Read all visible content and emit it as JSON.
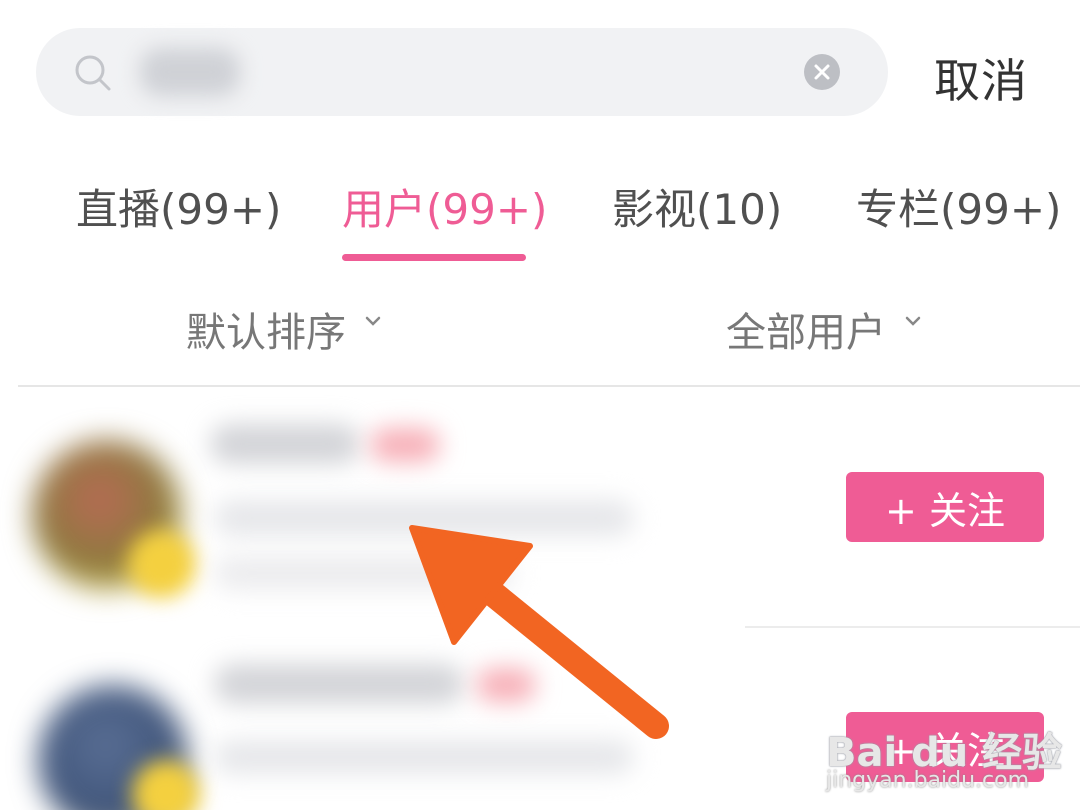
{
  "search": {
    "cancel_label": "取消"
  },
  "tabs": [
    {
      "label": "直播(99+)",
      "active": false
    },
    {
      "label": "用户(99+)",
      "active": true
    },
    {
      "label": "影视(10)",
      "active": false
    },
    {
      "label": "专栏(99+)",
      "active": false
    }
  ],
  "filters": [
    {
      "label": "默认排序",
      "icon": "chevron-down-icon"
    },
    {
      "label": "全部用户",
      "icon": "chevron-down-icon"
    }
  ],
  "results": [
    {
      "follow_label": "+ 关注"
    },
    {
      "follow_label": "+ 关注"
    }
  ],
  "watermark": {
    "brand": "Bai du 经验",
    "url": "jingyan.baidu.com"
  },
  "colors": {
    "accent": "#ef5c95",
    "arrow": "#f26522"
  }
}
